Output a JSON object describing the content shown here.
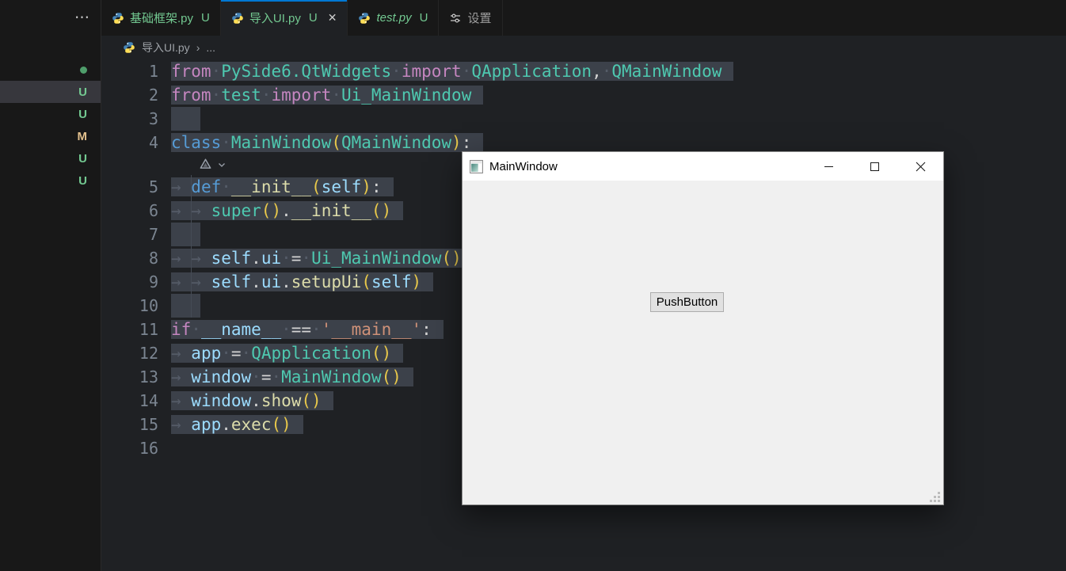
{
  "colors": {
    "accent_blue": "#0078d4",
    "git_untracked_green": "#73c991",
    "git_modified_orange": "#e2c08d",
    "editor_background": "#1f2124",
    "panel_background": "#181818",
    "inactive_selection": "#3c414a"
  },
  "sidebar": {
    "more": "⋯",
    "rows": [
      {
        "kind": "dot"
      },
      {
        "kind": "untracked",
        "badge": "U",
        "selected": true
      },
      {
        "kind": "untracked",
        "badge": "U"
      },
      {
        "kind": "modified",
        "badge": "M"
      },
      {
        "kind": "untracked",
        "badge": "U"
      },
      {
        "kind": "untracked",
        "badge": "U"
      }
    ]
  },
  "tabs": [
    {
      "label": "基础框架.py",
      "badge": "U",
      "icon": "python",
      "state": "inactive"
    },
    {
      "label": "导入UI.py",
      "badge": "U",
      "icon": "python",
      "state": "active",
      "close": "✕"
    },
    {
      "label": "test.py",
      "badge": "U",
      "icon": "python",
      "state": "inactive",
      "preview": true
    },
    {
      "label": "设置",
      "icon": "settings",
      "state": "inactive"
    }
  ],
  "breadcrumb": {
    "file": "导入UI.py",
    "sep": "›",
    "more": "..."
  },
  "editor": {
    "lines": [
      {
        "n": "1",
        "sel": true,
        "tokens": [
          [
            "kw",
            "from"
          ],
          [
            "ws",
            "·"
          ],
          [
            "ty",
            "PySide6.QtWidgets"
          ],
          [
            "ws",
            "·"
          ],
          [
            "kw",
            "import"
          ],
          [
            "ws",
            "·"
          ],
          [
            "ty",
            "QApplication"
          ],
          [
            "op",
            ","
          ],
          [
            "ws",
            "·"
          ],
          [
            "ty",
            "QMainWindow"
          ]
        ]
      },
      {
        "n": "2",
        "sel": true,
        "tokens": [
          [
            "kw",
            "from"
          ],
          [
            "ws",
            "·"
          ],
          [
            "ty",
            "test"
          ],
          [
            "ws",
            "·"
          ],
          [
            "kw",
            "import"
          ],
          [
            "ws",
            "·"
          ],
          [
            "ty",
            "Ui_MainWindow"
          ]
        ]
      },
      {
        "n": "3",
        "sel": true,
        "tokens": []
      },
      {
        "n": "4",
        "sel": true,
        "tokens": [
          [
            "st",
            "class"
          ],
          [
            "ws",
            "·"
          ],
          [
            "ty",
            "MainWindow"
          ],
          [
            "br",
            "("
          ],
          [
            "ty",
            "QMainWindow"
          ],
          [
            "br",
            ")"
          ],
          [
            "op",
            ":"
          ]
        ]
      },
      {
        "widget": true
      },
      {
        "n": "5",
        "sel": true,
        "guide": true,
        "tokens": [
          [
            "ws",
            "→ "
          ],
          [
            "st",
            "def"
          ],
          [
            "ws",
            "·"
          ],
          [
            "fn",
            "__init__"
          ],
          [
            "br",
            "("
          ],
          [
            "va",
            "self"
          ],
          [
            "br",
            ")"
          ],
          [
            "op",
            ":"
          ]
        ]
      },
      {
        "n": "6",
        "sel": true,
        "guide": true,
        "tokens": [
          [
            "ws",
            "→ → "
          ],
          [
            "ty",
            "super"
          ],
          [
            "br",
            "("
          ],
          [
            "br",
            ")"
          ],
          [
            "op",
            "."
          ],
          [
            "fn",
            "__init__"
          ],
          [
            "br",
            "("
          ],
          [
            "br",
            ")"
          ]
        ]
      },
      {
        "n": "7",
        "sel": true,
        "guide": true,
        "tokens": []
      },
      {
        "n": "8",
        "sel": true,
        "guide": true,
        "tokens": [
          [
            "ws",
            "→ → "
          ],
          [
            "va",
            "self"
          ],
          [
            "op",
            "."
          ],
          [
            "va",
            "ui"
          ],
          [
            "ws",
            "·"
          ],
          [
            "op",
            "="
          ],
          [
            "ws",
            "·"
          ],
          [
            "ty",
            "Ui_MainWindow"
          ],
          [
            "br",
            "("
          ],
          [
            "br",
            ")"
          ]
        ]
      },
      {
        "n": "9",
        "sel": true,
        "guide": true,
        "tokens": [
          [
            "ws",
            "→ → "
          ],
          [
            "va",
            "self"
          ],
          [
            "op",
            "."
          ],
          [
            "va",
            "ui"
          ],
          [
            "op",
            "."
          ],
          [
            "fn",
            "setupUi"
          ],
          [
            "br",
            "("
          ],
          [
            "va",
            "self"
          ],
          [
            "br",
            ")"
          ]
        ]
      },
      {
        "n": "10",
        "sel": true,
        "guide": true,
        "tokens": []
      },
      {
        "n": "11",
        "sel": true,
        "tokens": [
          [
            "kw",
            "if"
          ],
          [
            "ws",
            "·"
          ],
          [
            "va",
            "__name__"
          ],
          [
            "ws",
            "·"
          ],
          [
            "op",
            "=="
          ],
          [
            "ws",
            "·"
          ],
          [
            "str",
            "'__main__'"
          ],
          [
            "op",
            ":"
          ]
        ]
      },
      {
        "n": "12",
        "sel": true,
        "tokens": [
          [
            "ws",
            "→ "
          ],
          [
            "va",
            "app"
          ],
          [
            "ws",
            "·"
          ],
          [
            "op",
            "="
          ],
          [
            "ws",
            "·"
          ],
          [
            "ty",
            "QApplication"
          ],
          [
            "br",
            "("
          ],
          [
            "br",
            ")"
          ]
        ]
      },
      {
        "n": "13",
        "sel": true,
        "tokens": [
          [
            "ws",
            "→ "
          ],
          [
            "va",
            "window"
          ],
          [
            "ws",
            "·"
          ],
          [
            "op",
            "="
          ],
          [
            "ws",
            "·"
          ],
          [
            "ty",
            "MainWindow"
          ],
          [
            "br",
            "("
          ],
          [
            "br",
            ")"
          ]
        ]
      },
      {
        "n": "14",
        "sel": true,
        "tokens": [
          [
            "ws",
            "→ "
          ],
          [
            "va",
            "window"
          ],
          [
            "op",
            "."
          ],
          [
            "fn",
            "show"
          ],
          [
            "br",
            "("
          ],
          [
            "br",
            ")"
          ]
        ]
      },
      {
        "n": "15",
        "sel": true,
        "tokens": [
          [
            "ws",
            "→ "
          ],
          [
            "va",
            "app"
          ],
          [
            "op",
            "."
          ],
          [
            "fn",
            "exec"
          ],
          [
            "br",
            "("
          ],
          [
            "br",
            ")"
          ]
        ]
      },
      {
        "n": "16",
        "sel": false,
        "tokens": []
      }
    ]
  },
  "qt_window": {
    "title": "MainWindow",
    "push_button": "PushButton"
  }
}
